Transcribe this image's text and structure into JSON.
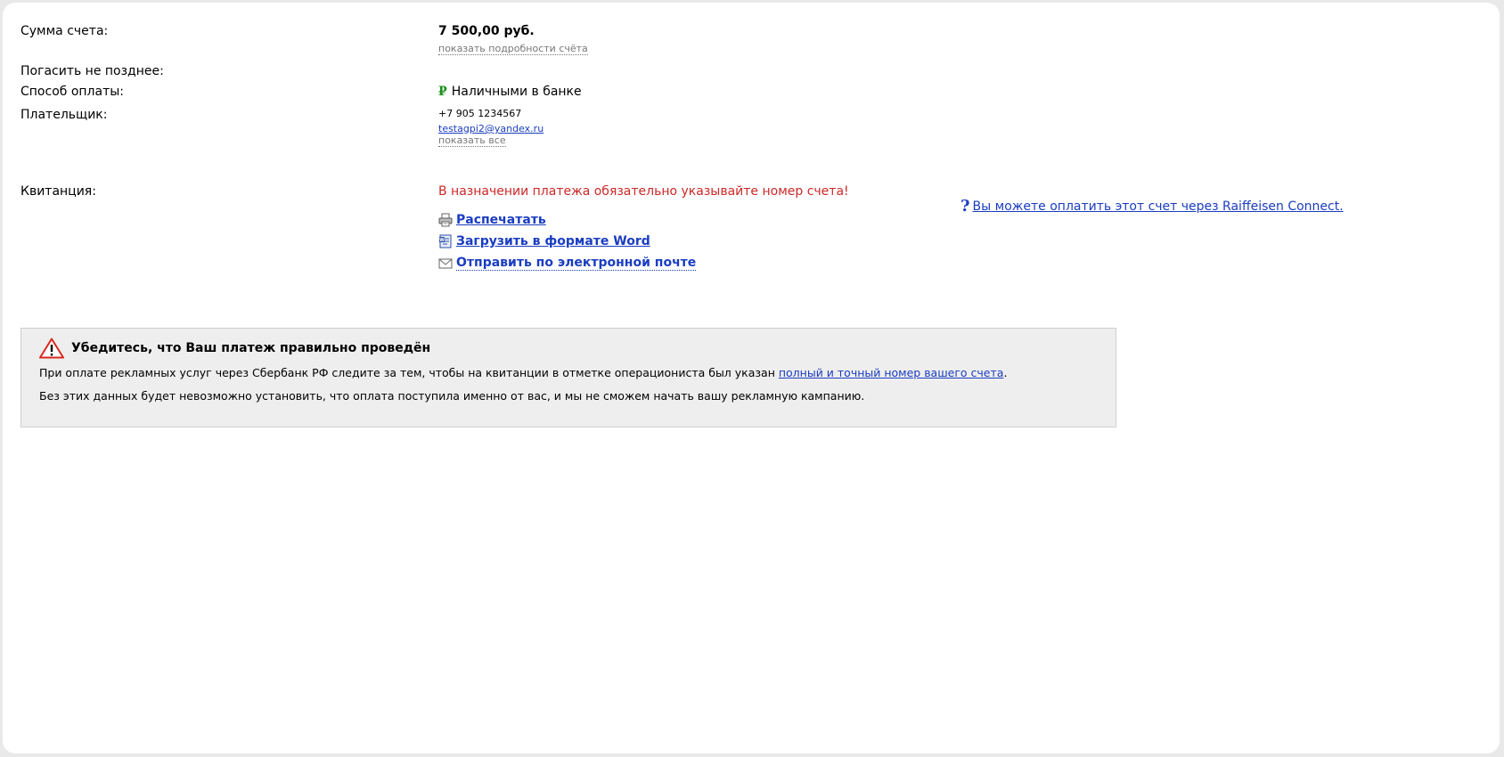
{
  "invoice": {
    "sum_label": "Сумма счета:",
    "sum_value": "7 500,00 руб.",
    "details_link": "показать подробности счёта",
    "due_label": "Погасить не позднее:",
    "due_value": "",
    "method_label": "Способ оплаты:",
    "method_icon": "ruble-icon",
    "method_value": "Наличными в банке",
    "payer_label": "Плательщик:",
    "payer_phone": "+7 905 1234567",
    "payer_email": "testagpi2@yandex.ru",
    "show_all_link": "показать все"
  },
  "receipt": {
    "label": "Квитанция:",
    "warning": "В назначении платежа обязательно указывайте номер счета!",
    "actions": [
      {
        "icon": "printer-icon",
        "label": "Распечатать"
      },
      {
        "icon": "word-doc-icon",
        "label": "Загрузить в формате Word"
      },
      {
        "icon": "envelope-icon",
        "label": "Отправить по электронной почте"
      }
    ],
    "raiffeisen_link": "Вы можете оплатить этот счет через Raiffeisen Connect."
  },
  "notice": {
    "title": "Убедитесь, что Ваш платеж правильно проведён",
    "line1_prefix": "При оплате рекламных услуг через Сбербанк РФ следите за тем, чтобы на квитанции в отметке операциониста был указан ",
    "line1_link": "полный и точный номер вашего счета",
    "line1_suffix": ".",
    "line2": "Без этих данных будет невозможно установить, что оплата поступила именно от вас, и мы не сможем начать вашу рекламную кампанию."
  },
  "colors": {
    "link": "#1a3dc1",
    "warning_red": "#cc2828",
    "ruble_green": "#1e8f1e",
    "notice_bg": "#eeeeee"
  }
}
